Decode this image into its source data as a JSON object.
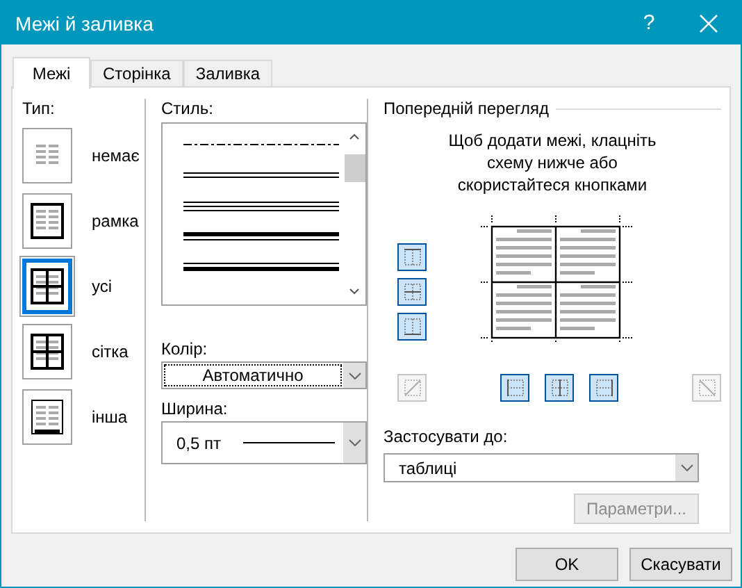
{
  "window": {
    "title": "Межі й заливка",
    "help": "?"
  },
  "tabs": [
    {
      "label": "Межі",
      "selected": true
    },
    {
      "label": "Сторінка",
      "selected": false
    },
    {
      "label": "Заливка",
      "selected": false
    }
  ],
  "type": {
    "label": "Тип:",
    "items": [
      {
        "kind": "none",
        "label": "немає",
        "selected": false
      },
      {
        "kind": "box",
        "label": "рамка",
        "selected": false
      },
      {
        "kind": "all",
        "label": "усі",
        "selected": true
      },
      {
        "kind": "grid",
        "label": "сітка",
        "selected": false
      },
      {
        "kind": "custom",
        "label": "інша",
        "selected": false
      }
    ]
  },
  "style": {
    "label": "Стиль:",
    "lines": [
      {
        "kind": "dash-dot"
      },
      {
        "kind": "double"
      },
      {
        "kind": "triple"
      },
      {
        "kind": "thick-thin"
      },
      {
        "kind": "thin-thick"
      }
    ]
  },
  "color": {
    "label": "Колір:",
    "value": "Автоматично"
  },
  "width": {
    "label": "Ширина:",
    "value": "0,5 пт"
  },
  "preview": {
    "label": "Попередній перегляд",
    "hint": "Щоб додати межі, клацніть схему нижче або скористайтеся кнопками",
    "side_buttons": [
      {
        "kind": "top",
        "on": true
      },
      {
        "kind": "middle-h",
        "on": true
      },
      {
        "kind": "bottom",
        "on": true
      }
    ],
    "bottom_buttons": [
      {
        "kind": "diag-up",
        "on": false,
        "disabled": true
      },
      {
        "kind": "left",
        "on": true,
        "disabled": false
      },
      {
        "kind": "middle-v",
        "on": true,
        "disabled": false
      },
      {
        "kind": "right",
        "on": true,
        "disabled": false
      },
      {
        "kind": "diag-down",
        "on": false,
        "disabled": true
      }
    ]
  },
  "apply_to": {
    "label": "Застосувати до:",
    "value": "таблиці"
  },
  "options_button": {
    "label": "Параметри...",
    "disabled": true
  },
  "buttons": [
    "OK",
    "Скасувати"
  ]
}
